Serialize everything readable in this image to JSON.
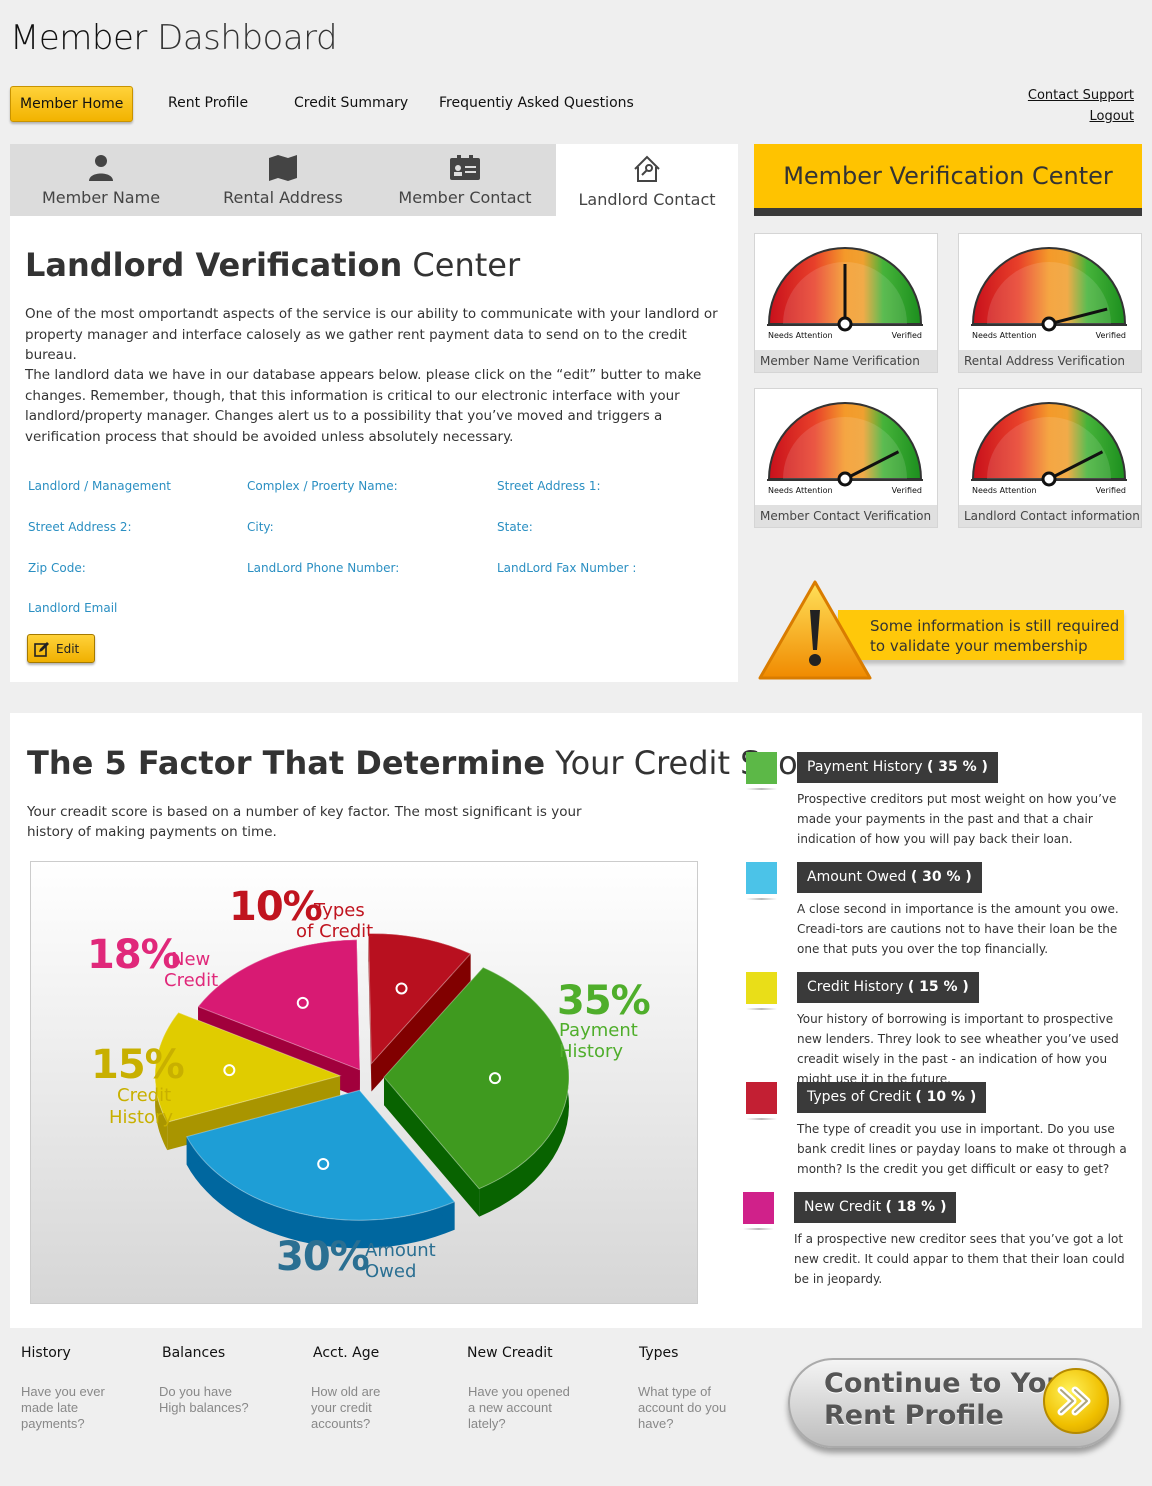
{
  "header": {
    "title_bold": "Member",
    "title_rest": " Dashboard"
  },
  "nav": {
    "items": [
      "Member Home",
      "Rent Profile",
      "Credit Summary",
      "Frequentiy Asked Questions"
    ],
    "support": "Contact Support",
    "logout": "Logout"
  },
  "tabs": [
    "Member Name",
    "Rental Address",
    "Member Contact",
    "Landlord Contact"
  ],
  "landlord": {
    "title_bold": "Landlord Verification",
    "title_rest": " Center",
    "para1": "One of the most omportandt aspects of the service is our ability to communicate with your landlord or property manager and interface calosely as we gather rent payment data to send on to the credit bureau.",
    "para2": "The landlord data we have in our database appears below. please click on the “edit” butter to make changes. Remember, though, that this information is critical to our electronic interface with your landlord/property manager. Changes alert us to a possibility that you’ve moved and triggers a verification process that should be avoided unless absolutely necessary.",
    "fields": [
      "Landlord / Management",
      "Complex / Proerty Name:",
      "Street Address 1:",
      "Street Address 2:",
      "City:",
      "State:",
      "Zip Code:",
      "LandLord Phone Number:",
      "LandLord Fax Number :",
      "Landlord Email"
    ],
    "edit": "Edit"
  },
  "verification": {
    "title": "Member Verification Center",
    "needs": "Needs Attention",
    "verified": "Verified",
    "gauges": [
      {
        "label": "Member Name Verification",
        "level": 0.5
      },
      {
        "label": "Rental Address Verification",
        "level": 0.92
      },
      {
        "label": "Member Contact Verification",
        "level": 0.85
      },
      {
        "label": "Landlord Contact information",
        "level": 0.85
      }
    ],
    "warning": "Some information is still required to validate your membership"
  },
  "credit": {
    "title_bold": "The 5 Factor That Determine",
    "title_rest": " Your Credit Score :",
    "desc": "Your creadit score is based on a number of key factor. The most significant is your history of making payments on time.",
    "factors": [
      {
        "name": "Payment History",
        "pct": "( 35 % )",
        "color": "#5cb847",
        "text": "Prospective creditors put most weight on how you’ve made your payments in the past and that a chair indication of how you will pay back their loan."
      },
      {
        "name": "Amount Owed",
        "pct": "( 30 % )",
        "color": "#4bc3e8",
        "text": "A close second in importance is the amount you owe. Creadi-tors are cautions not to have their loan be the one that puts you over the top financially."
      },
      {
        "name": "Credit History",
        "pct": "( 15 % )",
        "color": "#e9de18",
        "text": "Your history of borrowing is important to prospective new lenders. Threy look to see wheather you’ve used creadit wisely in the past - an indication of how you might use it in the future."
      },
      {
        "name": "Types of Credit",
        "pct": "( 10 % )",
        "color": "#c31f33",
        "text": "The type of creadit you use in important. Do you use bank credit lines or payday loans to make ot through a month? Is the credit you get difficult or easy to get?"
      },
      {
        "name": "New Credit",
        "pct": "( 18 % )",
        "color": "#d0218a",
        "text": "If a prospective new creditor sees that you’ve got a lot new credit. It could appar to them that their loan could be in jeopardy."
      }
    ],
    "pie_labels": {
      "types": {
        "pct": "10%",
        "l1": "Types",
        "l2": "of Credit"
      },
      "new": {
        "pct": "18%",
        "l1": "New",
        "l2": "Credit"
      },
      "history": {
        "pct": "15%",
        "l1": "Credit",
        "l2": "History"
      },
      "payment": {
        "pct": "35%",
        "l1": "Payment",
        "l2": "History"
      },
      "owed": {
        "pct": "30%",
        "l1": "Amount",
        "l2": "Owed"
      }
    }
  },
  "chart_data": {
    "type": "pie",
    "title": "",
    "categories": [
      "Payment History",
      "Amount Owed",
      "Credit History",
      "Types of Credit",
      "New Credit"
    ],
    "values": [
      35,
      30,
      15,
      10,
      18
    ],
    "colors": [
      "#3f9a1f",
      "#1e9ed6",
      "#e0cc00",
      "#b8101f",
      "#d81a73"
    ]
  },
  "footer": {
    "cols": [
      {
        "h": "History",
        "p": "Have you ever made late payments?"
      },
      {
        "h": "Balances",
        "p": "Do you have High balances?"
      },
      {
        "h": "Acct. Age",
        "p": "How old are your credit accounts?"
      },
      {
        "h": "New Creadit",
        "p": "Have you opened a new account lately?"
      },
      {
        "h": "Types",
        "p": "What type of account do you have?"
      }
    ],
    "cta_l1": "Continue to Your",
    "cta_l2": "Rent Profile"
  }
}
